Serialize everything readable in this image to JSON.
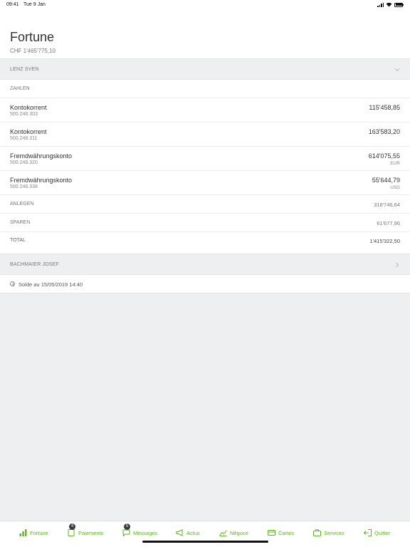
{
  "status_bar": {
    "time": "09:41",
    "date": "Tue 9 Jan"
  },
  "header": {
    "title": "Fortune",
    "subtitle": "CHF 1'465'775,10"
  },
  "groups": {
    "lenz": {
      "label": "LENZ SVEN",
      "icon": "chevron-down-icon"
    },
    "bachmaier": {
      "label": "BACHMAIER JOSEF",
      "icon": "chevron-right-icon"
    }
  },
  "sections": {
    "zahlen": "ZAHLEN"
  },
  "accounts": [
    {
      "name": "Kontokorrent",
      "number": "500.248.303",
      "amount": "115'458,85",
      "currency": ""
    },
    {
      "name": "Kontokorrent",
      "number": "500.248.311",
      "amount": "163'583,20",
      "currency": ""
    },
    {
      "name": "Fremdwährungskonto",
      "number": "500.248.320",
      "amount": "614'075,55",
      "currency": "EUR"
    },
    {
      "name": "Fremdwährungskonto",
      "number": "500.248.338",
      "amount": "55'644,79",
      "currency": "USD"
    }
  ],
  "categories": [
    {
      "label": "ANLEGEN",
      "value": "318'746,64"
    },
    {
      "label": "SPAREN",
      "value": "61'677,96"
    }
  ],
  "total": {
    "label": "TOTAL",
    "value": "1'415'322,50"
  },
  "solde": {
    "text": "Solde au 15/05/2019 14:40",
    "icon": "clock-icon"
  },
  "tabs": [
    {
      "label": "Fortune",
      "icon": "bar-chart-icon",
      "badge": ""
    },
    {
      "label": "Paiements",
      "icon": "document-icon",
      "badge": "4"
    },
    {
      "label": "Messages",
      "icon": "chat-icon",
      "badge": "5"
    },
    {
      "label": "Actus",
      "icon": "megaphone-icon",
      "badge": ""
    },
    {
      "label": "Négoce",
      "icon": "trend-icon",
      "badge": ""
    },
    {
      "label": "Cartes",
      "icon": "card-icon",
      "badge": ""
    },
    {
      "label": "Services",
      "icon": "briefcase-icon",
      "badge": ""
    },
    {
      "label": "Quitter",
      "icon": "logout-icon",
      "badge": ""
    }
  ],
  "colors": {
    "accent": "#5cb41e",
    "background": "#eeeff1",
    "badge": "#3a3a3a"
  }
}
